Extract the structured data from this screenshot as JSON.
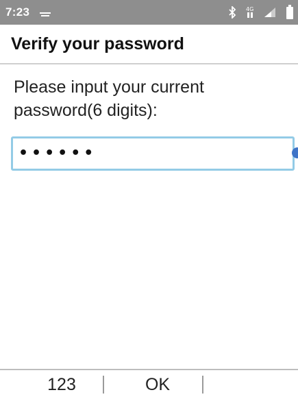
{
  "status_bar": {
    "time": "7:23",
    "icons": [
      "notification-icon",
      "bluetooth-icon",
      "4g-icon",
      "signal-icon",
      "battery-icon"
    ]
  },
  "header": {
    "title": "Verify your password"
  },
  "main": {
    "prompt": "Please input your current password(6 digits):",
    "password_field": {
      "value": "••••••"
    }
  },
  "softkeys": {
    "left": "123",
    "center": "OK",
    "right": ""
  },
  "colors": {
    "status_bar": "#8e8e8e",
    "field_border": "#93cbe6",
    "cursor_handle": "#3f74c7"
  }
}
